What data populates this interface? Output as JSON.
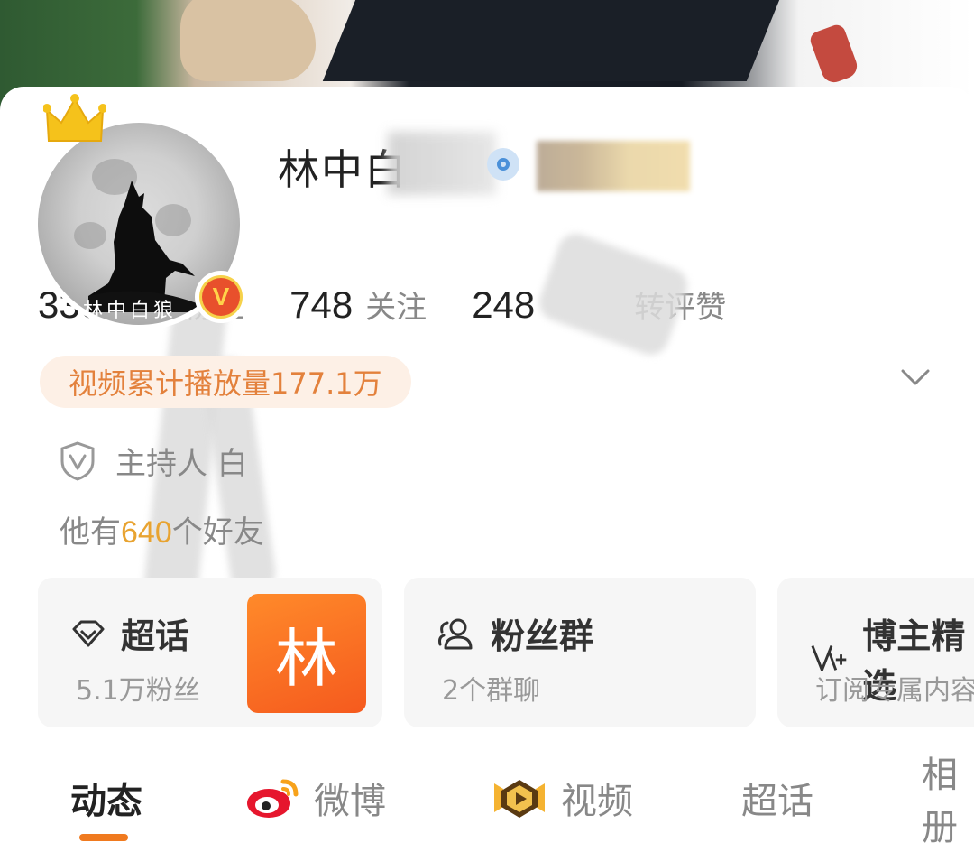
{
  "cover": {
    "alt": "cover-banner"
  },
  "profile": {
    "avatar_text": "林中白狼",
    "name": "林中白",
    "verify_badge": "V"
  },
  "stats": [
    {
      "value": "330.1万",
      "label": "粉丝"
    },
    {
      "value": "748",
      "label": "关注"
    },
    {
      "value": "248",
      "label": "转评赞"
    }
  ],
  "video_pill": "视频累计播放量177.1万",
  "role": "主持人 白",
  "friends": {
    "prefix": "他有",
    "count": "640",
    "suffix": "个好友"
  },
  "feature_cards": [
    {
      "title": "超话",
      "sub": "5.1万粉丝",
      "thumb": "林",
      "icon": "diamond-icon"
    },
    {
      "title": "粉丝群",
      "sub": "2个群聊",
      "icon": "group-icon"
    },
    {
      "title": "博主精选",
      "sub": "订阅专属内容",
      "icon": "v-plus-icon"
    }
  ],
  "tabs": [
    {
      "label": "动态",
      "active": true
    },
    {
      "label": "微博",
      "icon": "weibo-icon"
    },
    {
      "label": "视频",
      "icon": "video-icon"
    },
    {
      "label": "超话"
    },
    {
      "label": "相册"
    }
  ],
  "colors": {
    "accent": "#f07a1f",
    "highlight": "#e8a330",
    "pill_bg": "#fdf0e6",
    "pill_text": "#e3813c",
    "card_bg": "#f6f6f6",
    "verify_red": "#e8502c",
    "verify_gold": "#f6d24b"
  }
}
